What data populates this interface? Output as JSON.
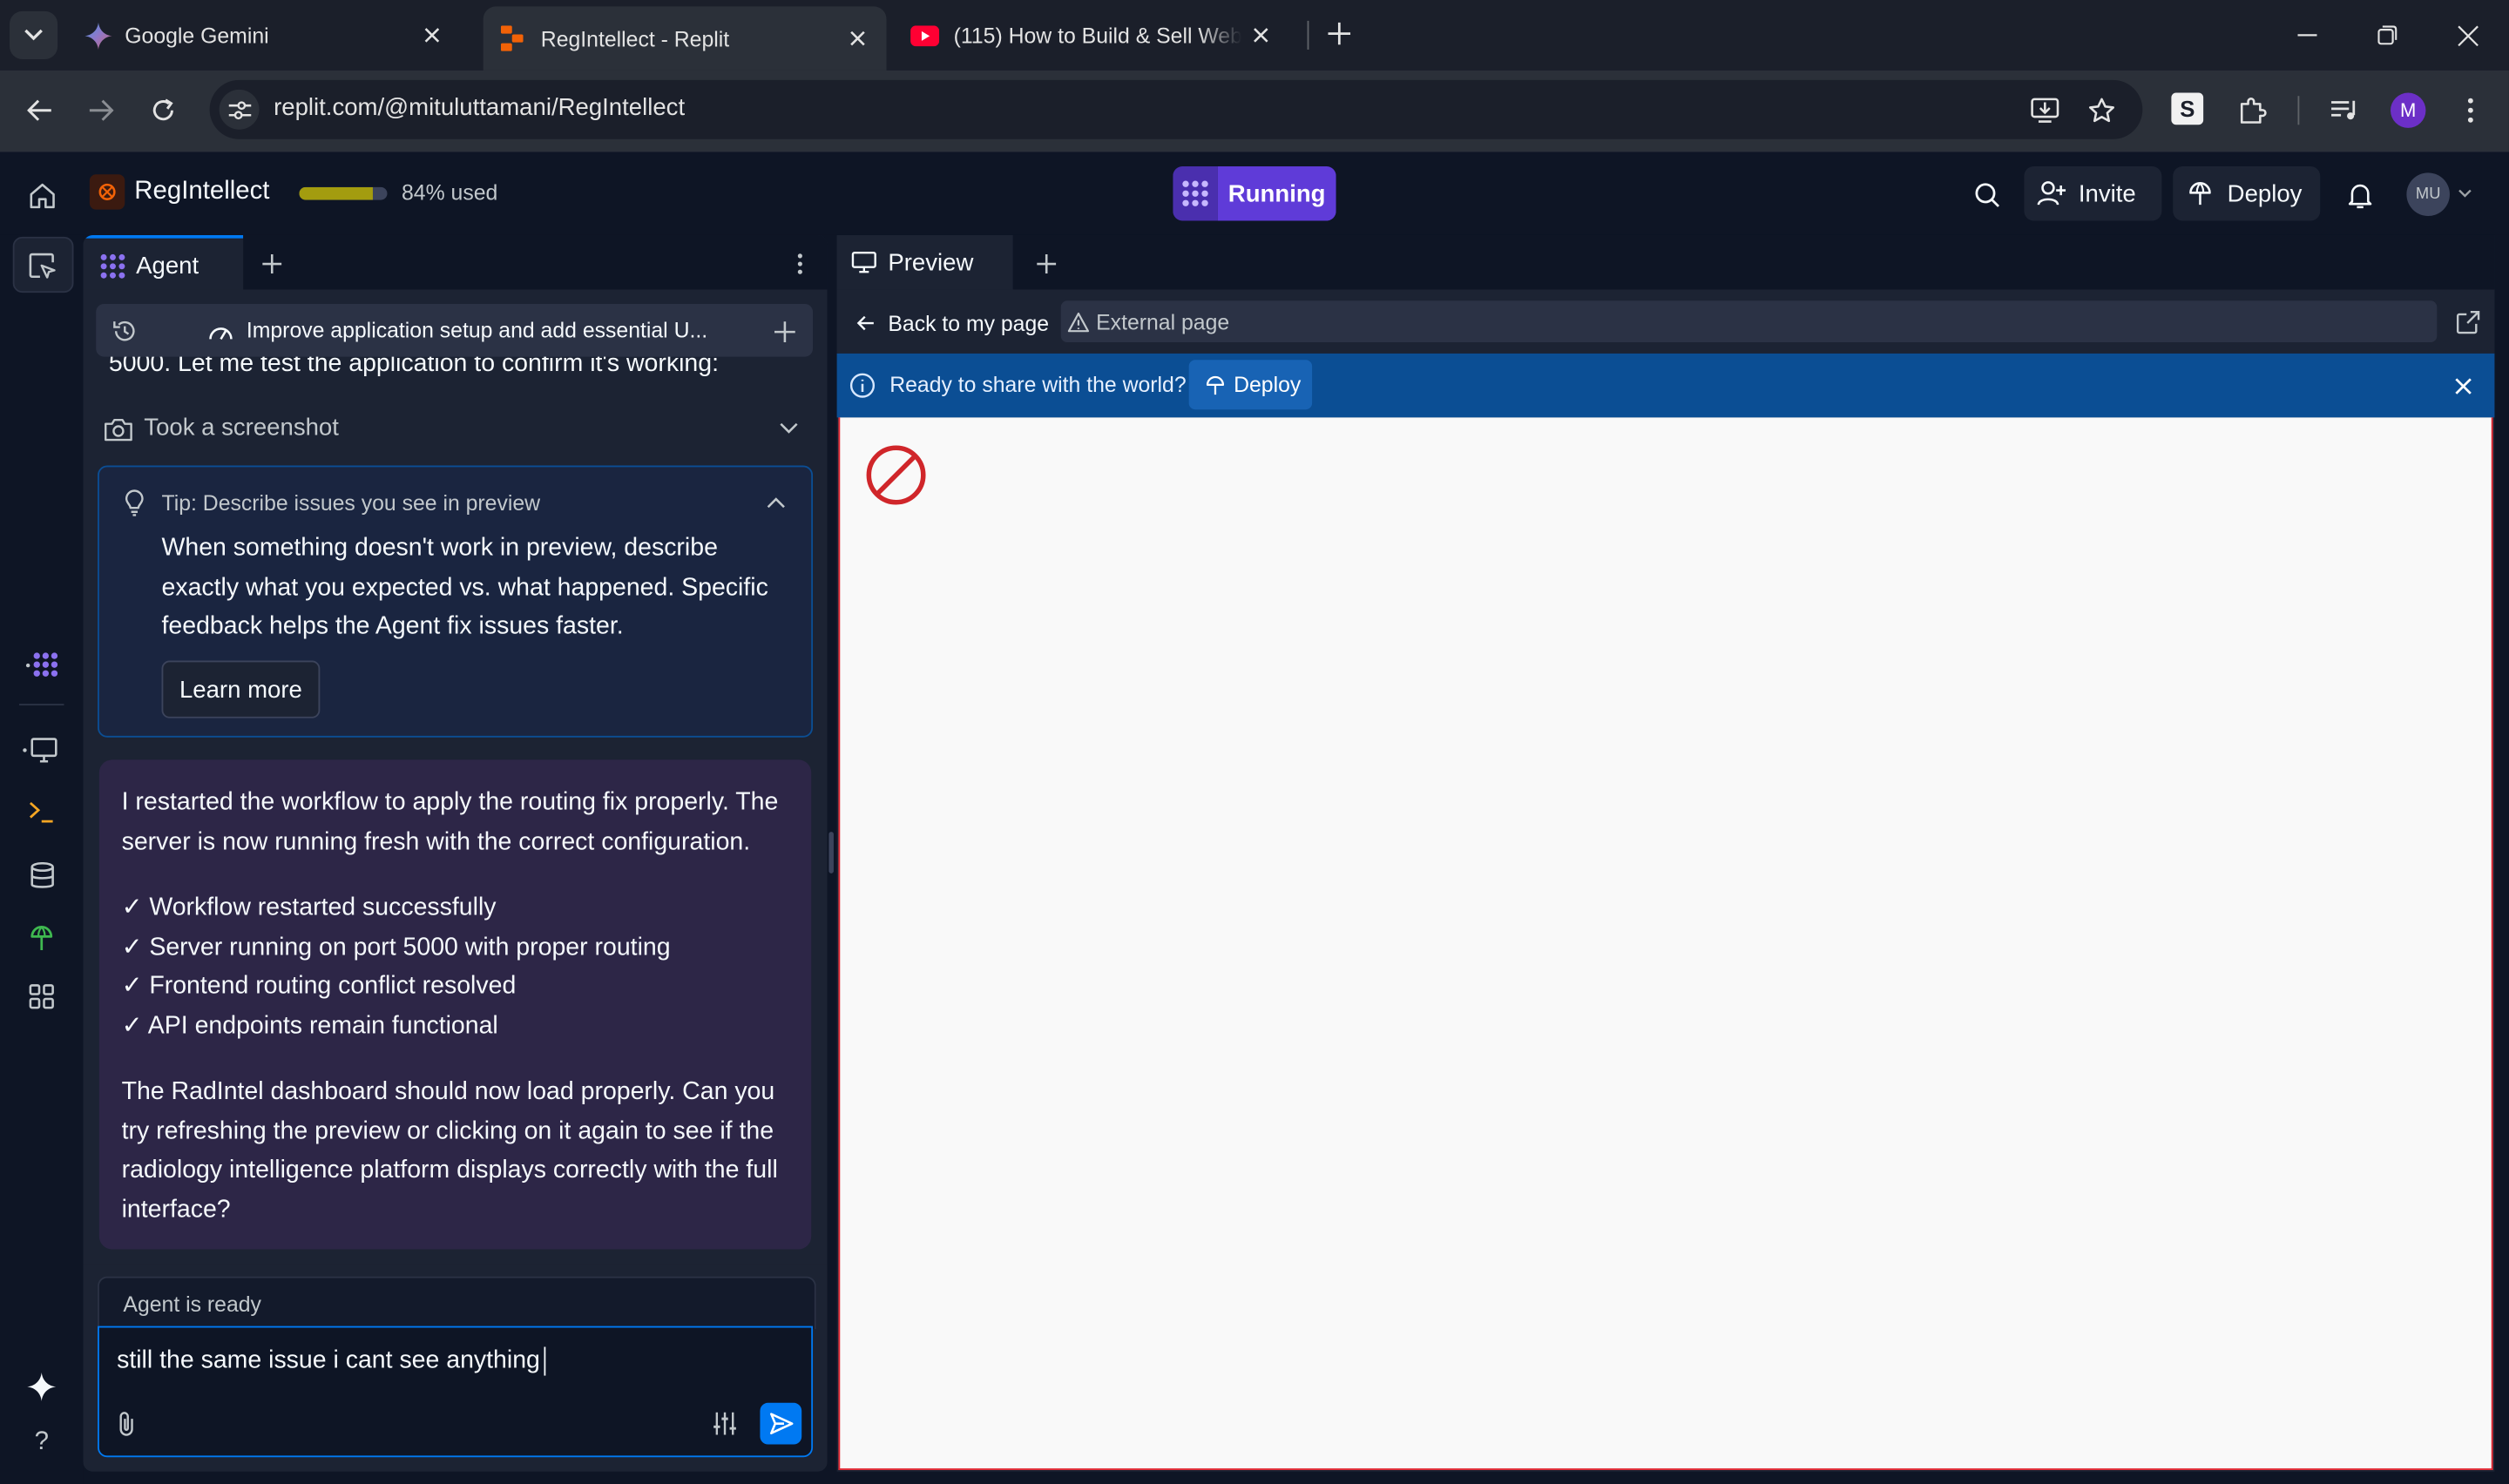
{
  "browser": {
    "tabs": [
      {
        "title": "Google Gemini",
        "icon": "gemini-icon"
      },
      {
        "title": "RegIntellect - Replit",
        "icon": "replit-icon",
        "active": true
      },
      {
        "title": "(115) How to Build & Sell Web",
        "icon": "youtube-icon"
      }
    ],
    "url": "replit.com/@mituluttamani/RegIntellect",
    "profile_initial": "M",
    "extension_label": "S"
  },
  "header": {
    "app_name": "RegIntellect",
    "usage_percent": 84,
    "usage_label": "84% used",
    "run_label": "Running",
    "invite_label": "Invite",
    "deploy_label": "Deploy",
    "avatar_initials": "MU"
  },
  "agent": {
    "tab_label": "Agent",
    "thread_title": "Improve application setup and add essential U...",
    "partial_text": "5000. Let me test the application to confirm it's working:",
    "screenshot_label": "Took a screenshot",
    "tip": {
      "title": "Tip: Describe issues you see in preview",
      "body": "When something doesn't work in preview, describe exactly what you expected vs. what happened. Specific feedback helps the Agent fix issues faster.",
      "button": "Learn more"
    },
    "message": {
      "intro": "I restarted the workflow to apply the routing fix properly. The server is now running fresh with the correct configuration.",
      "checks": [
        "✓ Workflow restarted successfully",
        "✓ Server running on port 5000 with proper routing",
        "✓ Frontend routing conflict resolved",
        "✓ API endpoints remain functional"
      ],
      "outro": "The RadIntel dashboard should now load properly. Can you try refreshing the preview or clicking on it again to see if the radiology intelligence platform displays correctly with the full interface?"
    },
    "status": "Agent is ready",
    "input_value": "still the same issue i cant see anything"
  },
  "preview": {
    "tab_label": "Preview",
    "back_label": "Back to my page",
    "external_label": "External page",
    "banner_text": "Ready to share with the world?",
    "banner_deploy": "Deploy"
  },
  "colors": {
    "bg": "#0e1525",
    "panel": "#1c2333",
    "accent_purple": "#5f3bd8",
    "banner_blue": "#0b4e94",
    "send_blue": "#0079f2",
    "usage_fill": "#a39c0f"
  }
}
